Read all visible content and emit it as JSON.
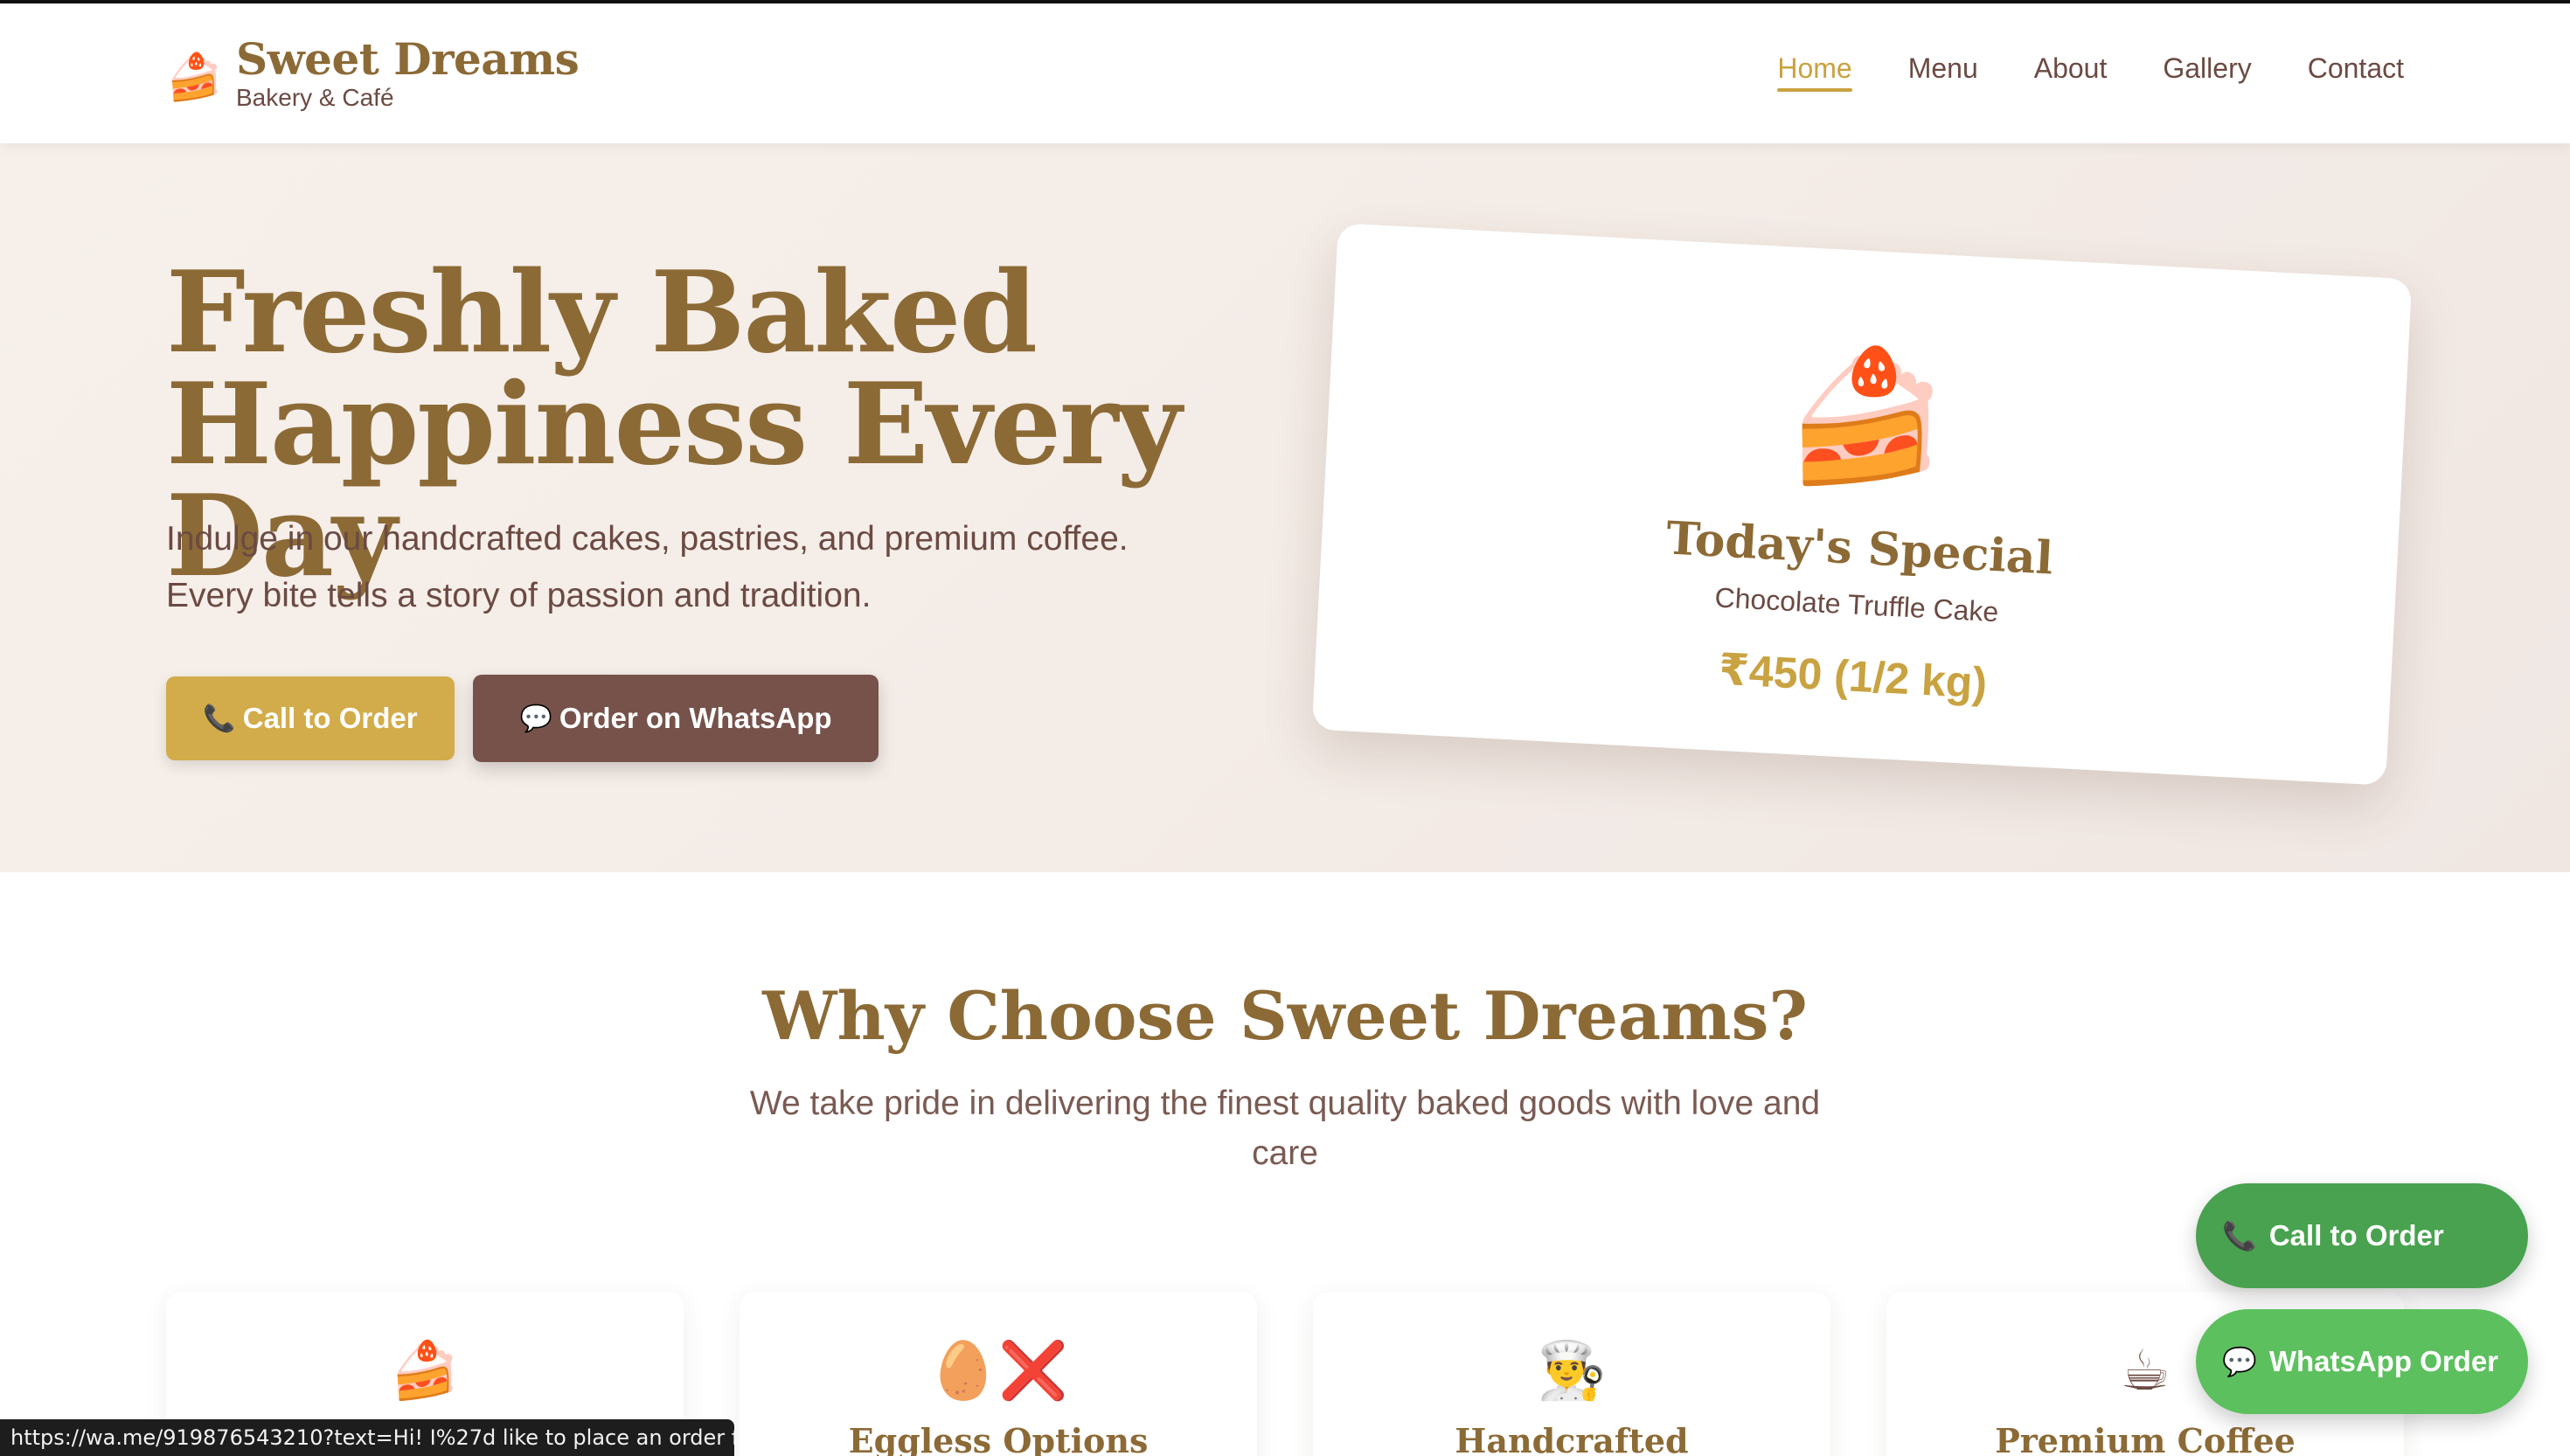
{
  "brand": {
    "title": "Sweet Dreams",
    "subtitle": "Bakery & Café",
    "icon": "cake-icon"
  },
  "nav": {
    "items": [
      {
        "label": "Home",
        "active": true
      },
      {
        "label": "Menu",
        "active": false
      },
      {
        "label": "About",
        "active": false
      },
      {
        "label": "Gallery",
        "active": false
      },
      {
        "label": "Contact",
        "active": false
      }
    ]
  },
  "hero": {
    "title_line1": "Freshly Baked",
    "title_line2": "Happiness Every Day",
    "desc_line1": "Indulge in our handcrafted cakes, pastries, and premium coffee.",
    "desc_line2": "Every bite tells a story of passion and tradition.",
    "call_button": "Call to Order",
    "whatsapp_button": "Order on WhatsApp"
  },
  "special": {
    "icon": "🍰",
    "title": "Today's Special",
    "item": "Chocolate Truffle Cake",
    "price": "₹450 (1/2 kg)"
  },
  "why": {
    "title": "Why Choose Sweet Dreams?",
    "desc": "We take pride in delivering the finest quality baked goods with love and care",
    "cards": [
      {
        "icon": "🍰",
        "title": ""
      },
      {
        "icon": "🥚❌",
        "title": "Eggless Options"
      },
      {
        "icon": "👨‍🍳",
        "title": "Handcrafted"
      },
      {
        "icon": "☕",
        "title": "Premium Coffee"
      }
    ]
  },
  "floating": {
    "call_label": "Call to Order",
    "whatsapp_label": "WhatsApp Order"
  },
  "status_url": "https://wa.me/919876543210?text=Hi! I%27d like to place an order for...",
  "colors": {
    "gold": "#c9a241",
    "brown_title": "#8c6a36",
    "text_brown": "#6b4a43",
    "whatsapp_green": "#5cc05e",
    "call_green": "#48a24f"
  }
}
